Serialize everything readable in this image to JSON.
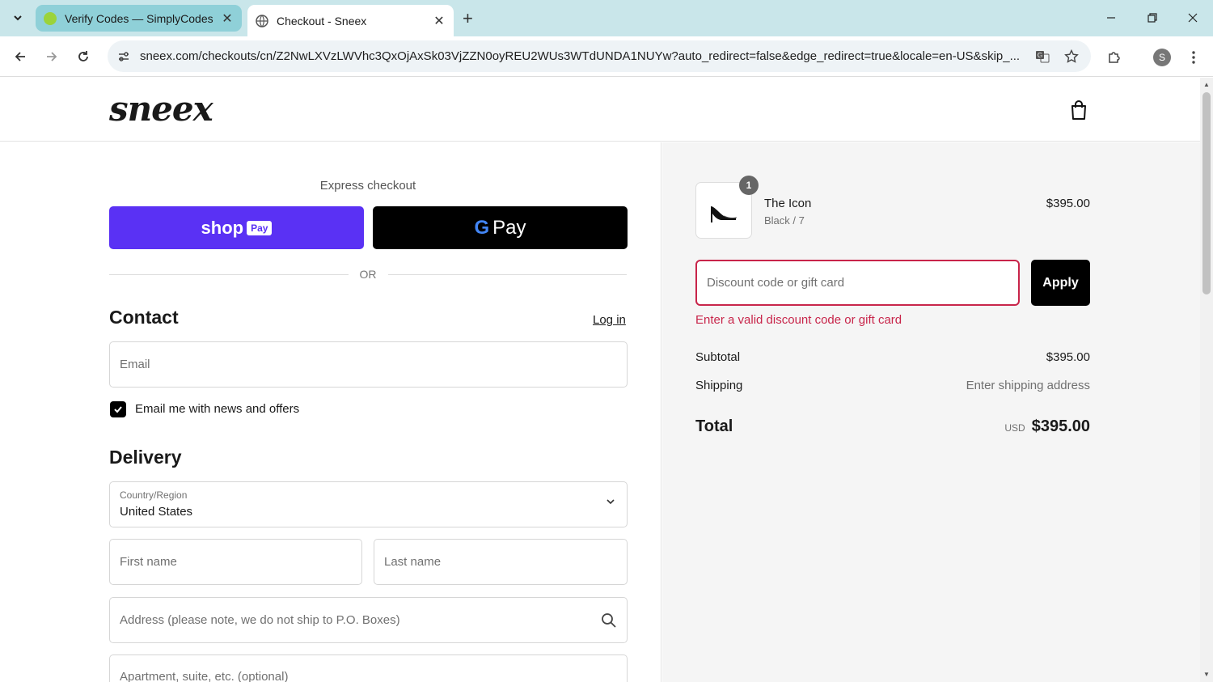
{
  "browser": {
    "tabs": [
      {
        "title": "Verify Codes — SimplyCodes",
        "active": false
      },
      {
        "title": "Checkout - Sneex",
        "active": true
      }
    ],
    "url": "sneex.com/checkouts/cn/Z2NwLXVzLWVhc3QxOjAxSk03VjZZN0oyREU2WUs3WTdUNDA1NUYw?auto_redirect=false&edge_redirect=true&locale=en-US&skip_...",
    "profile_initial": "S"
  },
  "header": {
    "logo": "sneex"
  },
  "express": {
    "label": "Express checkout",
    "shop_label": "shop",
    "shop_pay": "Pay",
    "gpay_g": "G",
    "gpay_label": "Pay",
    "or": "OR"
  },
  "contact": {
    "heading": "Contact",
    "login": "Log in",
    "email_placeholder": "Email",
    "newsletter_label": "Email me with news and offers",
    "newsletter_checked": true
  },
  "delivery": {
    "heading": "Delivery",
    "country_label": "Country/Region",
    "country_value": "United States",
    "first_name_placeholder": "First name",
    "last_name_placeholder": "Last name",
    "address_placeholder": "Address (please note, we do not ship to P.O. Boxes)",
    "apartment_placeholder": "Apartment, suite, etc. (optional)"
  },
  "summary": {
    "product": {
      "name": "The Icon",
      "variant": "Black / 7",
      "price": "$395.00",
      "quantity": "1"
    },
    "discount_placeholder": "Discount code or gift card",
    "apply_label": "Apply",
    "error": "Enter a valid discount code or gift card",
    "subtotal_label": "Subtotal",
    "subtotal_value": "$395.00",
    "shipping_label": "Shipping",
    "shipping_value": "Enter shipping address",
    "total_label": "Total",
    "currency": "USD",
    "total_value": "$395.00"
  },
  "colors": {
    "shop_pay": "#5a31f4",
    "error": "#c8254a",
    "tab_bar": "#c9e6ea"
  }
}
